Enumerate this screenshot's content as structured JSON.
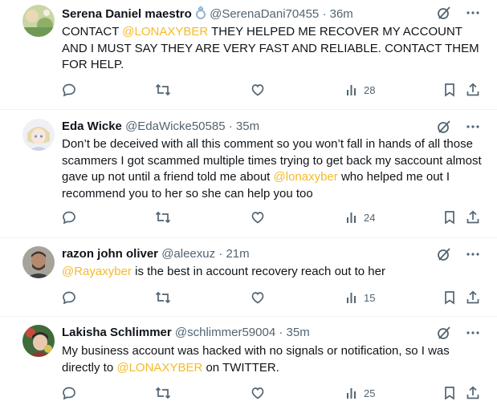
{
  "tweets": [
    {
      "name": "Serena Daniel maestro",
      "name_badge": "ring-emoji",
      "handle": "@SerenaDani70455",
      "time": "36m",
      "text_parts": [
        {
          "t": "CONTACT ",
          "m": false
        },
        {
          "t": "@LONAXYBER",
          "m": true
        },
        {
          "t": " THEY HELPED ME RECOVER MY ACCOUNT AND I MUST SAY THEY ARE VERY FAST AND RELIABLE. CONTACT THEM FOR HELP.",
          "m": false
        }
      ],
      "views": "28"
    },
    {
      "name": "Eda Wicke",
      "handle": "@EdaWicke50585",
      "time": "35m",
      "text_parts": [
        {
          "t": "Don’t be deceived with all this comment so you won’t fall in hands of all those scammers I got scammed multiple times trying to get back my saccount almost gave up not until a friend told me about ",
          "m": false
        },
        {
          "t": "@lonaxyber",
          "m": true
        },
        {
          "t": " who helped me out I recommend you to her so she can help you too",
          "m": false
        }
      ],
      "views": "24"
    },
    {
      "name": "razon john oliver",
      "handle": "@aleexuz",
      "time": "21m",
      "text_parts": [
        {
          "t": "@Rayaxyber",
          "m": true
        },
        {
          "t": " is the best in account recovery reach out to her",
          "m": false
        }
      ],
      "views": "15"
    },
    {
      "name": "Lakisha Schlimmer",
      "handle": "@schlimmer59004",
      "time": "35m",
      "text_parts": [
        {
          "t": "My business account was hacked with no signals or notification, so I was directly to ",
          "m": false
        },
        {
          "t": "@LONAXYBER",
          "m": true
        },
        {
          "t": " on TWITTER.",
          "m": false
        }
      ],
      "views": "25"
    }
  ],
  "separator": "·",
  "colors": {
    "text": "#0f1419",
    "secondary": "#536471",
    "mention": "#f4ba2b",
    "divider": "#eff3f4"
  }
}
